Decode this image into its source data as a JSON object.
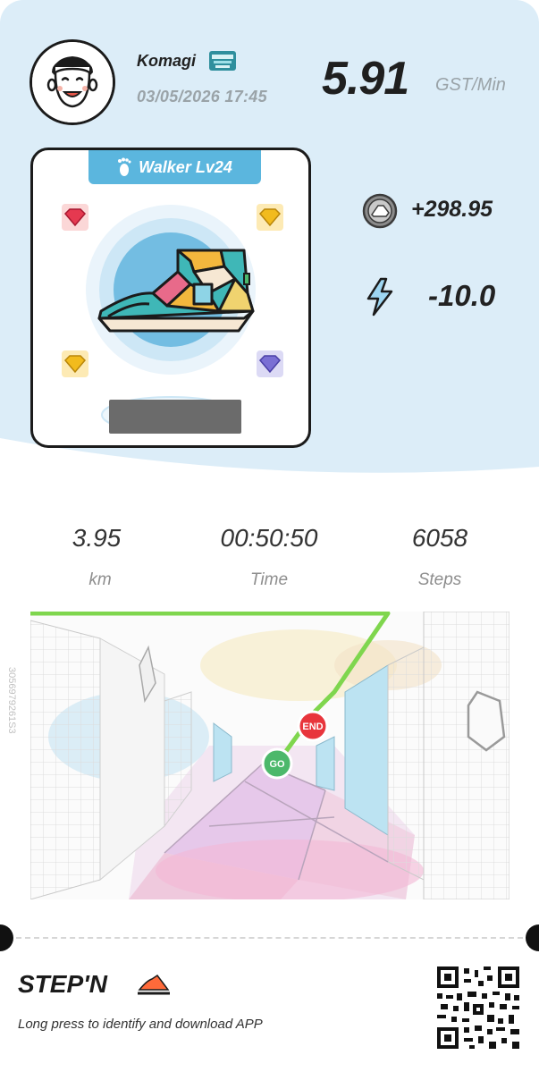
{
  "user": {
    "name": "Komagi",
    "datetime": "03/05/2026 17:45"
  },
  "rate": {
    "value": "5.91",
    "unit": "GST/Min"
  },
  "shoe": {
    "tag": "Walker Lv24",
    "gems": [
      "ruby",
      "topaz",
      "topaz",
      "amethyst"
    ]
  },
  "earnings": {
    "gst": "+298.95",
    "energy": "-10.0"
  },
  "stats": [
    {
      "value": "3.95",
      "label": "km"
    },
    {
      "value": "00:50:50",
      "label": "Time"
    },
    {
      "value": "6058",
      "label": "Steps"
    }
  ],
  "map": {
    "start_label": "GO",
    "end_label": "END",
    "vertical_id": "3056979261S3"
  },
  "footer": {
    "logo_text": "STEP'N",
    "tagline": "Long press to identify and download APP"
  },
  "colors": {
    "top_bg": "#dcedf8",
    "tab_blue": "#5bb6de",
    "route_green": "#7fd64e",
    "go_green": "#4cb86b",
    "end_red": "#e8353c"
  },
  "icons": {
    "earn": "gst-coin-icon",
    "energy": "lightning-icon",
    "tab": "footprint-icon"
  }
}
